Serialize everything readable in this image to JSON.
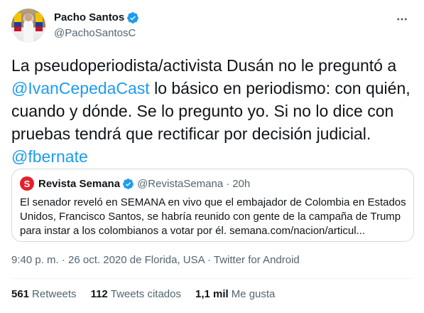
{
  "author": {
    "display_name": "Pacho Santos",
    "handle": "@PachoSantosC"
  },
  "tweet": {
    "line1": "La pseudoperiodista/activista Dusán no le preguntó a",
    "mention1": "@IvanCepedaCast",
    "line2_rest": " lo básico en periodismo: con quién,",
    "line3": "cuando y dónde. Se lo pregunto yo. Si no lo dice con",
    "line4": "pruebas tendrá que rectificar por decisión judicial.",
    "mention2": "@fbernate"
  },
  "quote": {
    "logo_letter": "S",
    "name": "Revista Semana",
    "handle": "@RevistaSemana",
    "separator": "·",
    "age": "20h",
    "body": "El senador reveló en SEMANA en vivo que el embajador de Colombia en Estados Unidos, Francisco Santos, se habría reunido con gente de la campaña de Trump para instar a los colombianos a votar por él. semana.com/nacion/articul..."
  },
  "meta": {
    "timestamp": "9:40 p. m. · 26 oct. 2020 de Florida, USA · Twitter for Android"
  },
  "stats": {
    "retweets_count": "561",
    "retweets_label": "Retweets",
    "quotes_count": "112",
    "quotes_label": "Tweets citados",
    "likes_count": "1,1 mil",
    "likes_label": "Me gusta"
  },
  "colors": {
    "accent": "#1d9bf0",
    "muted": "#536471",
    "brand_semana": "#e4202e"
  },
  "icons": [
    "verified-badge-icon",
    "more-options-icon"
  ]
}
